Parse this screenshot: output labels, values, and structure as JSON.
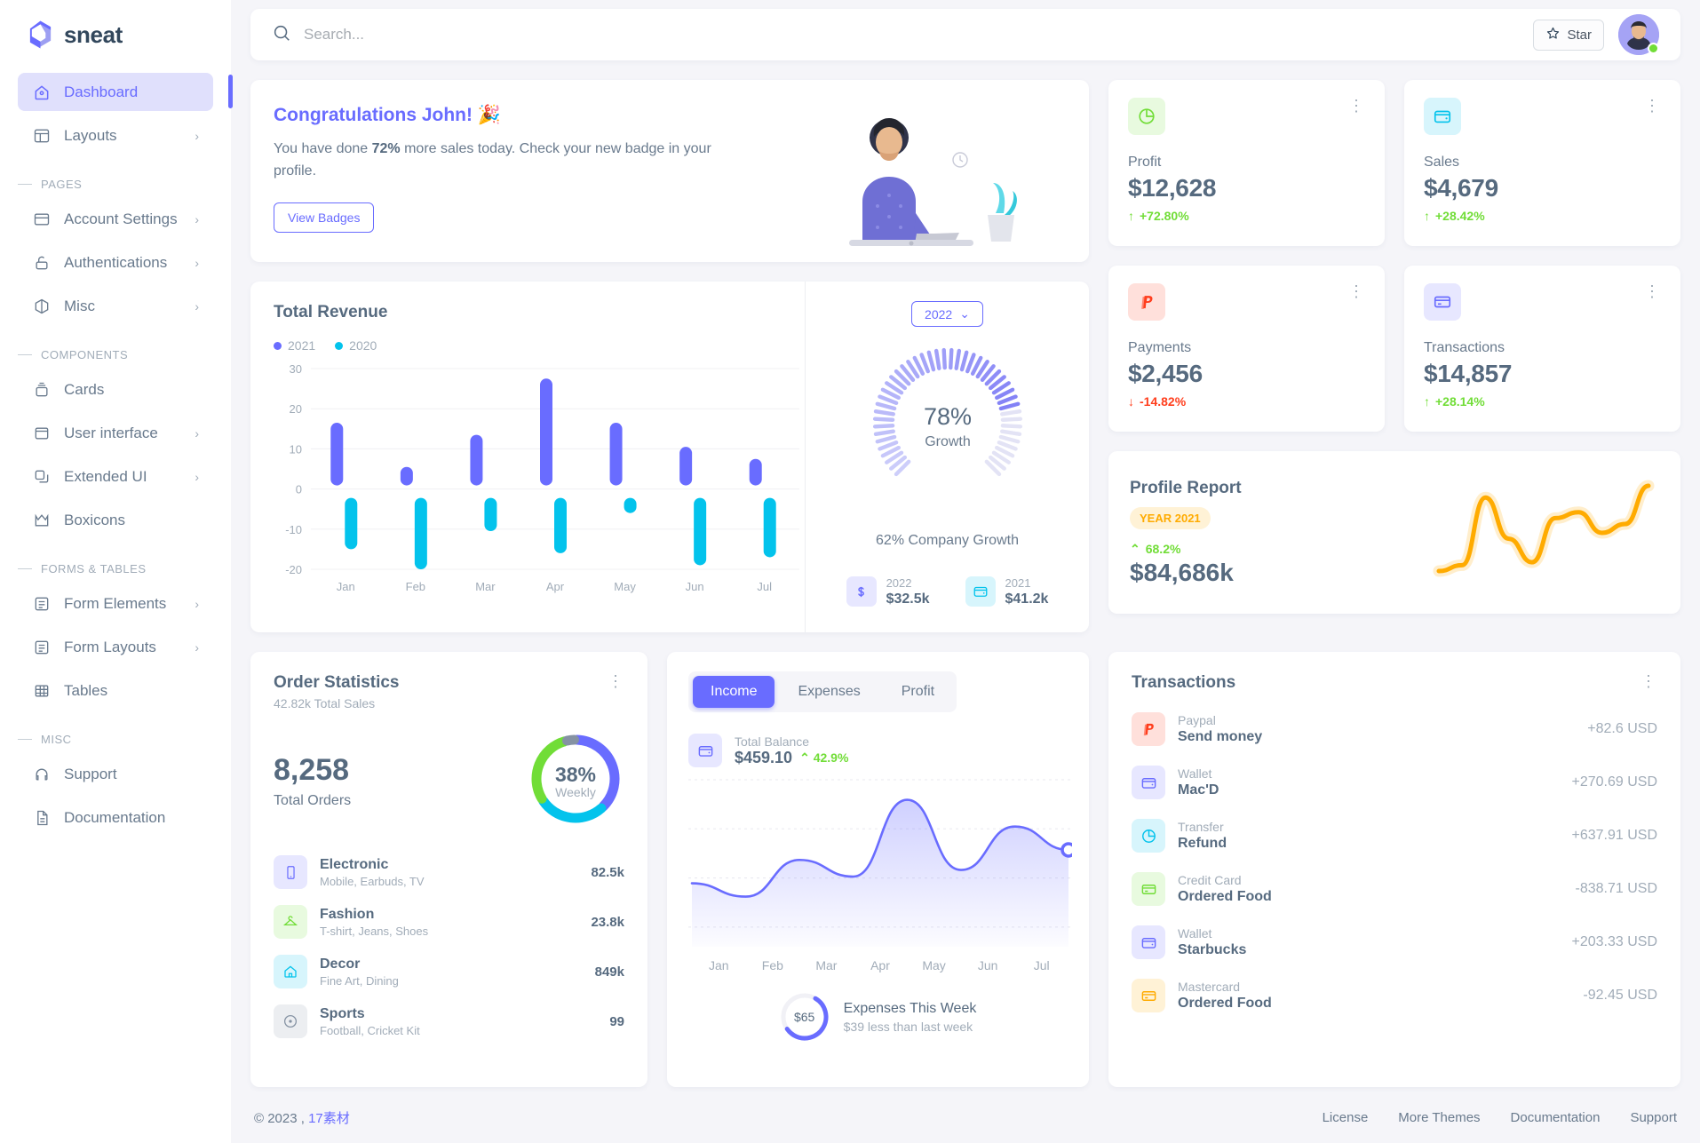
{
  "brand": {
    "name": "sneat"
  },
  "sidebar": {
    "items": [
      {
        "label": "Dashboard",
        "icon": "home-icon",
        "active": true,
        "chevron": false
      },
      {
        "label": "Layouts",
        "icon": "layout-icon",
        "active": false,
        "chevron": true
      }
    ],
    "sections": [
      {
        "title": "PAGES",
        "items": [
          {
            "label": "Account Settings",
            "icon": "account-settings-icon",
            "chevron": true
          },
          {
            "label": "Authentications",
            "icon": "lock-icon",
            "chevron": true
          },
          {
            "label": "Misc",
            "icon": "box-icon",
            "chevron": true
          }
        ]
      },
      {
        "title": "COMPONENTS",
        "items": [
          {
            "label": "Cards",
            "icon": "cards-icon",
            "chevron": false
          },
          {
            "label": "User interface",
            "icon": "ui-icon",
            "chevron": true
          },
          {
            "label": "Extended UI",
            "icon": "extended-ui-icon",
            "chevron": true
          },
          {
            "label": "Boxicons",
            "icon": "boxicons-icon",
            "chevron": false
          }
        ]
      },
      {
        "title": "FORMS & TABLES",
        "items": [
          {
            "label": "Form Elements",
            "icon": "form-elements-icon",
            "chevron": true
          },
          {
            "label": "Form Layouts",
            "icon": "form-layouts-icon",
            "chevron": true
          },
          {
            "label": "Tables",
            "icon": "table-icon",
            "chevron": false
          }
        ]
      },
      {
        "title": "MISC",
        "items": [
          {
            "label": "Support",
            "icon": "support-icon",
            "chevron": false
          },
          {
            "label": "Documentation",
            "icon": "document-icon",
            "chevron": false
          }
        ]
      }
    ]
  },
  "topbar": {
    "search_placeholder": "Search...",
    "search_value": "",
    "star_label": "Star"
  },
  "congrats": {
    "title": "Congratulations John!",
    "emoji": "🎉",
    "text_before": "You have done ",
    "highlight": "72%",
    "text_after": " more sales today. Check your new badge in your profile.",
    "button_label": "View Badges"
  },
  "stats": [
    {
      "label": "Profit",
      "value": "$12,628",
      "delta": "+72.80%",
      "direction": "up",
      "icon": "chart-pie-icon",
      "icon_bg": "#e8fadf",
      "icon_color": "#71dd37"
    },
    {
      "label": "Sales",
      "value": "$4,679",
      "delta": "+28.42%",
      "direction": "up",
      "icon": "wallet-icon",
      "icon_bg": "#d7f5fc",
      "icon_color": "#03c3ec"
    },
    {
      "label": "Payments",
      "value": "$2,456",
      "delta": "-14.82%",
      "direction": "down",
      "icon": "paypal-icon",
      "icon_bg": "#ffe0db",
      "icon_color": "#ff3e1d"
    },
    {
      "label": "Transactions",
      "value": "$14,857",
      "delta": "+28.14%",
      "direction": "up",
      "icon": "credit-card-icon",
      "icon_bg": "#e7e7ff",
      "icon_color": "#696cff"
    }
  ],
  "revenue": {
    "title": "Total Revenue",
    "legend": [
      {
        "label": "2021",
        "color": "#696cff"
      },
      {
        "label": "2020",
        "color": "#03c3ec"
      }
    ],
    "year_selected": "2022",
    "growth_value": "78%",
    "growth_label": "Growth",
    "company_growth": "62% Company Growth",
    "footer": [
      {
        "year": "2022",
        "value": "$32.5k",
        "icon": "dollar-icon",
        "icon_bg": "#e7e7ff",
        "icon_color": "#696cff"
      },
      {
        "year": "2021",
        "value": "$41.2k",
        "icon": "wallet-icon",
        "icon_bg": "#d7f5fc",
        "icon_color": "#03c3ec"
      }
    ]
  },
  "profile_report": {
    "title": "Profile Report",
    "badge": "YEAR 2021",
    "delta": "68.2%",
    "value": "$84,686k",
    "accent": "#ffab00"
  },
  "order_stats": {
    "title": "Order Statistics",
    "subtitle": "42.82k Total Sales",
    "total_orders": "8,258",
    "total_orders_label": "Total Orders",
    "donut_center_value": "38%",
    "donut_center_label": "Weekly",
    "categories": [
      {
        "name": "Electronic",
        "desc": "Mobile, Earbuds, TV",
        "value": "82.5k",
        "icon": "mobile-icon",
        "icon_bg": "#e7e7ff",
        "icon_color": "#696cff"
      },
      {
        "name": "Fashion",
        "desc": "T-shirt, Jeans, Shoes",
        "value": "23.8k",
        "icon": "hanger-icon",
        "icon_bg": "#e8fadf",
        "icon_color": "#71dd37"
      },
      {
        "name": "Decor",
        "desc": "Fine Art, Dining",
        "value": "849k",
        "icon": "home-decor-icon",
        "icon_bg": "#d7f5fc",
        "icon_color": "#03c3ec"
      },
      {
        "name": "Sports",
        "desc": "Football, Cricket Kit",
        "value": "99",
        "icon": "sports-icon",
        "icon_bg": "#eceef1",
        "icon_color": "#8592a3"
      }
    ]
  },
  "income": {
    "tabs": [
      {
        "label": "Income",
        "active": true
      },
      {
        "label": "Expenses",
        "active": false
      },
      {
        "label": "Profit",
        "active": false
      }
    ],
    "balance_label": "Total Balance",
    "balance_value": "$459.10",
    "balance_delta": "42.9%",
    "expenses_title": "Expenses This Week",
    "expenses_sub": "$39 less than last week",
    "expenses_amount": "$65"
  },
  "transactions": {
    "title": "Transactions",
    "rows": [
      {
        "type": "Paypal",
        "name": "Send money",
        "amount": "+82.6",
        "currency": "USD",
        "icon": "paypal-icon",
        "icon_bg": "#ffe0db",
        "icon_color": "#ff3e1d"
      },
      {
        "type": "Wallet",
        "name": "Mac'D",
        "amount": "+270.69",
        "currency": "USD",
        "icon": "wallet-icon",
        "icon_bg": "#e7e7ff",
        "icon_color": "#696cff"
      },
      {
        "type": "Transfer",
        "name": "Refund",
        "amount": "+637.91",
        "currency": "USD",
        "icon": "chart-pie-icon",
        "icon_bg": "#d7f5fc",
        "icon_color": "#03c3ec"
      },
      {
        "type": "Credit Card",
        "name": "Ordered Food",
        "amount": "-838.71",
        "currency": "USD",
        "icon": "credit-card-icon",
        "icon_bg": "#e8fadf",
        "icon_color": "#71dd37"
      },
      {
        "type": "Wallet",
        "name": "Starbucks",
        "amount": "+203.33",
        "currency": "USD",
        "icon": "wallet-icon",
        "icon_bg": "#e7e7ff",
        "icon_color": "#696cff"
      },
      {
        "type": "Mastercard",
        "name": "Ordered Food",
        "amount": "-92.45",
        "currency": "USD",
        "icon": "credit-card-icon",
        "icon_bg": "#fff2d6",
        "icon_color": "#ffab00"
      }
    ]
  },
  "footer": {
    "copyright": "© 2023 , ",
    "copyright_link": "17素材",
    "links": [
      "License",
      "More Themes",
      "Documentation",
      "Support"
    ]
  },
  "chart_data": [
    {
      "type": "bar",
      "title": "Total Revenue",
      "categories": [
        "Jan",
        "Feb",
        "Mar",
        "Apr",
        "May",
        "Jun",
        "Jul"
      ],
      "series": [
        {
          "name": "2021",
          "color": "#696cff",
          "values": [
            16.5,
            5.5,
            13.5,
            27.5,
            16.5,
            10.5,
            7.5
          ]
        },
        {
          "name": "2020",
          "color": "#03c3ec",
          "values": [
            -15,
            -20,
            -10.5,
            -16,
            -6,
            -19,
            -17
          ]
        }
      ],
      "ylim": [
        -20,
        30
      ],
      "yticks": [
        30,
        20,
        10,
        0,
        -10,
        -20
      ],
      "xlabel": "",
      "ylabel": "",
      "grid": true,
      "legend": "top-left"
    },
    {
      "type": "gauge",
      "title": "Growth",
      "value": 78,
      "display": "78%",
      "caption": "62% Company Growth",
      "color": "#696cff"
    },
    {
      "type": "line",
      "title": "Profile Report",
      "color": "#ffab00",
      "values": [
        8,
        12,
        58,
        30,
        14,
        44,
        48,
        34,
        40,
        66
      ],
      "ylim": [
        0,
        70
      ],
      "grid": false
    },
    {
      "type": "pie",
      "title": "Order Statistics",
      "labels": [
        "Electronic",
        "Fashion",
        "Decor",
        "Sports"
      ],
      "values": [
        38,
        28,
        30,
        4
      ],
      "colors": [
        "#696cff",
        "#03c3ec",
        "#71dd37",
        "#8592a3"
      ],
      "center_value": "38%",
      "center_label": "Weekly"
    },
    {
      "type": "area",
      "title": "Income",
      "categories": [
        "Jan",
        "Feb",
        "Mar",
        "Apr",
        "May",
        "Jun",
        "Jul"
      ],
      "values": [
        38,
        30,
        52,
        42,
        88,
        46,
        72,
        58
      ],
      "color": "#696cff",
      "ylim": [
        0,
        100
      ],
      "grid": true
    }
  ]
}
